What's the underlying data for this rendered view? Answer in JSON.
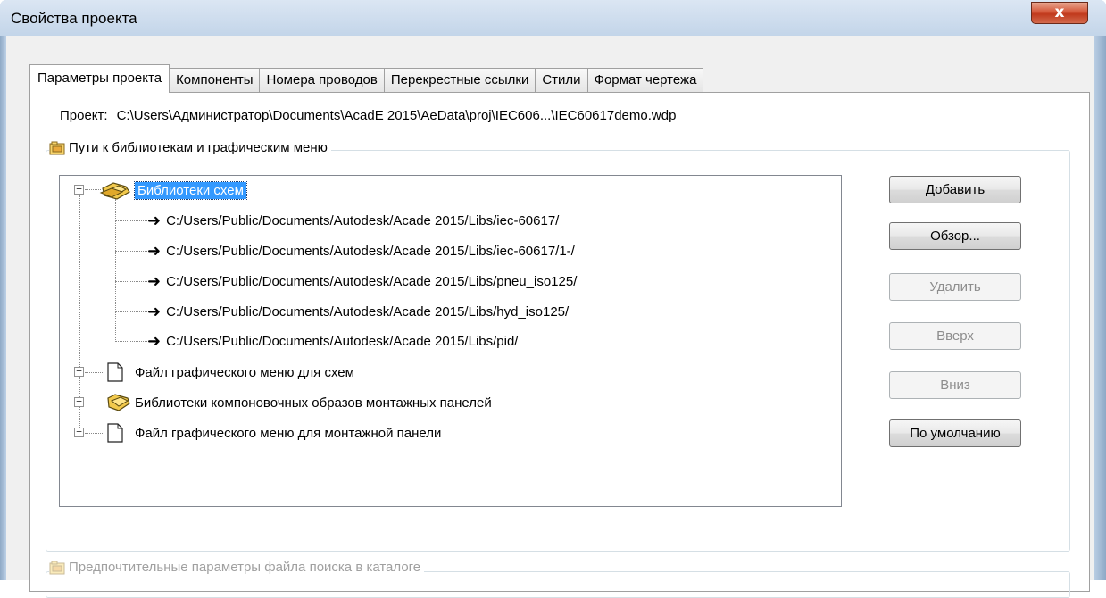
{
  "window": {
    "title": "Свойства проекта",
    "close_label": "x"
  },
  "tabs": [
    {
      "label": "Параметры проекта",
      "active": true
    },
    {
      "label": "Компоненты",
      "active": false
    },
    {
      "label": "Номера проводов",
      "active": false
    },
    {
      "label": "Перекрестные ссылки",
      "active": false
    },
    {
      "label": "Стили",
      "active": false
    },
    {
      "label": "Формат чертежа",
      "active": false
    }
  ],
  "project": {
    "label": "Проект:",
    "path": "C:\\Users\\Администратор\\Documents\\AcadE 2015\\AeData\\proj\\IEC606...\\IEC60617demo.wdp"
  },
  "library_group": {
    "legend": "Пути к библиотекам и графическим меню"
  },
  "tree": {
    "root_label": "Библиотеки схем",
    "root_expander": "−",
    "children": [
      "C:/Users/Public/Documents/Autodesk/Acade 2015/Libs/iec-60617/",
      "C:/Users/Public/Documents/Autodesk/Acade 2015/Libs/iec-60617/1-/",
      "C:/Users/Public/Documents/Autodesk/Acade 2015/Libs/pneu_iso125/",
      "C:/Users/Public/Documents/Autodesk/Acade 2015/Libs/hyd_iso125/",
      "C:/Users/Public/Documents/Autodesk/Acade 2015/Libs/pid/"
    ],
    "collapsed": [
      {
        "label": "Файл графического меню для схем",
        "icon": "document-icon"
      },
      {
        "label": "Библиотеки компоновочных образов монтажных панелей",
        "icon": "folder-icon"
      },
      {
        "label": "Файл графического меню для монтажной панели",
        "icon": "document-icon"
      }
    ],
    "collapsed_expander": "+"
  },
  "buttons": {
    "add": "Добавить",
    "browse": "Обзор...",
    "remove": "Удалить",
    "up": "Вверх",
    "down": "Вниз",
    "default": "По умолчанию"
  },
  "catalog_group": {
    "legend": "Предпочтительные параметры файла поиска в каталоге"
  }
}
